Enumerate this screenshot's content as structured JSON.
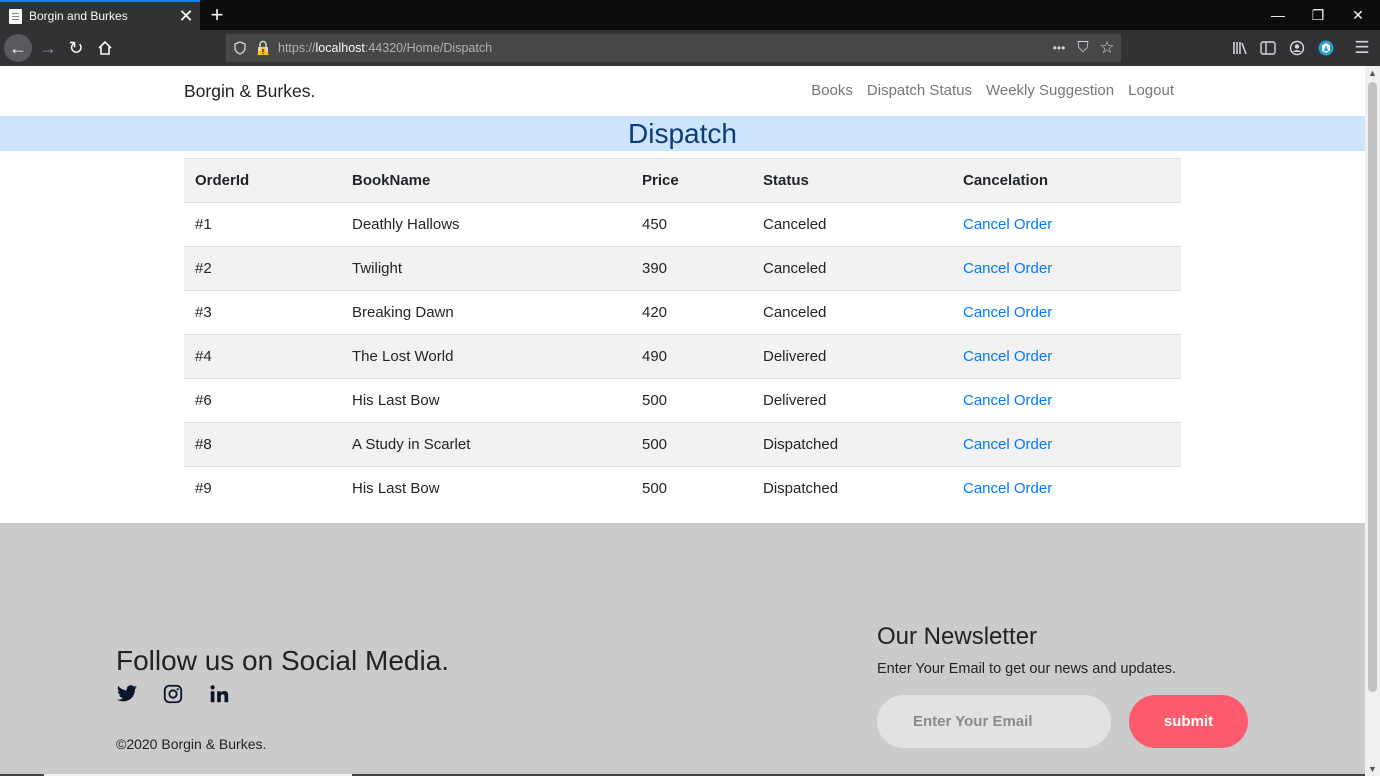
{
  "browser": {
    "tab_title": "Borgin and Burkes",
    "new_tab": "+",
    "close_tab": "✕",
    "window_controls": {
      "minimize": "—",
      "restore": "❐",
      "close": "✕"
    },
    "url_scheme": "https://",
    "url_host": "localhost",
    "url_path": ":44320/Home/Dispatch",
    "url_actions": {
      "more": "•••",
      "pocket": "⛉",
      "bookmark": "☆"
    }
  },
  "site": {
    "brand": "Borgin & Burkes.",
    "nav": [
      "Books",
      "Dispatch Status",
      "Weekly Suggestion",
      "Logout"
    ],
    "page_title": "Dispatch"
  },
  "table": {
    "headers": [
      "OrderId",
      "BookName",
      "Price",
      "Status",
      "Cancelation"
    ],
    "rows": [
      {
        "id": "#1",
        "book": "Deathly Hallows",
        "price": "450",
        "status": "Canceled",
        "action": "Cancel Order"
      },
      {
        "id": "#2",
        "book": "Twilight",
        "price": "390",
        "status": "Canceled",
        "action": "Cancel Order"
      },
      {
        "id": "#3",
        "book": "Breaking Dawn",
        "price": "420",
        "status": "Canceled",
        "action": "Cancel Order"
      },
      {
        "id": "#4",
        "book": "The Lost World",
        "price": "490",
        "status": "Delivered",
        "action": "Cancel Order"
      },
      {
        "id": "#6",
        "book": "His Last Bow",
        "price": "500",
        "status": "Delivered",
        "action": "Cancel Order"
      },
      {
        "id": "#8",
        "book": "A Study in Scarlet",
        "price": "500",
        "status": "Dispatched",
        "action": "Cancel Order"
      },
      {
        "id": "#9",
        "book": "His Last Bow",
        "price": "500",
        "status": "Dispatched",
        "action": "Cancel Order"
      }
    ]
  },
  "footer": {
    "follow_title": "Follow us on Social Media.",
    "socials": [
      "twitter-icon",
      "instagram-icon",
      "linkedin-icon"
    ],
    "copyright": "©2020 Borgin & Burkes.",
    "newsletter_title": "Our Newsletter",
    "newsletter_text": "Enter Your Email to get our news and updates.",
    "email_placeholder": "Enter Your Email",
    "submit_label": "submit"
  },
  "colors": {
    "accent_link": "#007bff",
    "title_band": "#cce5fc",
    "title_text": "#0b3d7d",
    "footer_bg": "#cbcbcb",
    "submit_bg": "#fd5b6c"
  }
}
